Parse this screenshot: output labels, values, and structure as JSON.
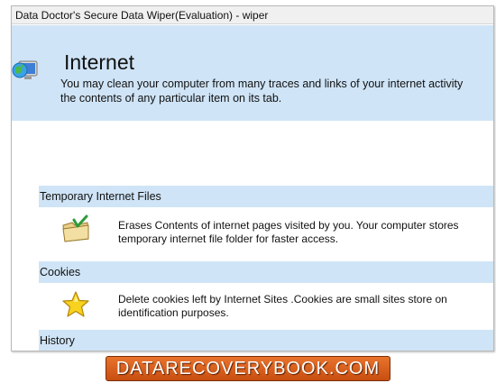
{
  "window": {
    "title": "Data Doctor's Secure Data Wiper(Evaluation) - wiper"
  },
  "header": {
    "title": "Internet",
    "desc_line1": "You may clean your computer from many traces and links of your internet activity",
    "desc_line2": "the contents of any particular item on its tab."
  },
  "sections": [
    {
      "title": "Temporary Internet Files",
      "icon": "folder-check-icon",
      "line1": "Erases Contents of internet pages visited by you. Your computer stores",
      "line2": "temporary internet file folder for faster access."
    },
    {
      "title": "Cookies",
      "icon": "star-icon",
      "line1": "Delete cookies left by Internet Sites .Cookies are small sites store on",
      "line2": "identification purposes."
    },
    {
      "title": "History"
    }
  ],
  "banner": {
    "text": "DATARECOVERYBOOK.COM"
  },
  "colors": {
    "header_bg": "#cfe4f6",
    "banner_bg": "#d8601c"
  }
}
